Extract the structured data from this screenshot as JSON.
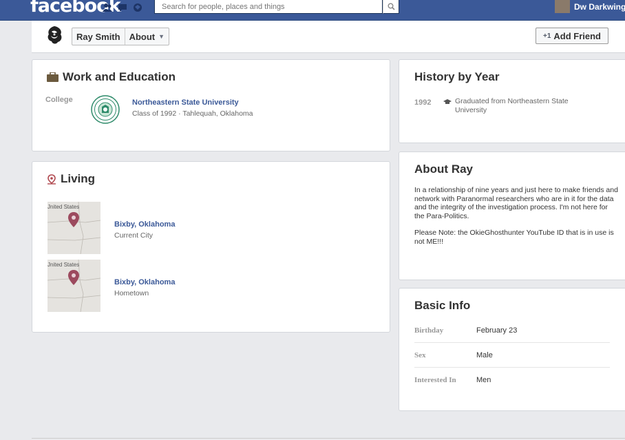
{
  "topbar": {
    "logo": "facebook",
    "search_placeholder": "Search for people, places and things",
    "user_name": "Dw Darkwing"
  },
  "profile": {
    "name": "Ray Smith",
    "about_label": "About",
    "add_friend_label": "Add Friend"
  },
  "work": {
    "title": "Work and Education",
    "college_label": "College",
    "school_name": "Northeastern State University",
    "school_detail": "Class of 1992 · Tahlequah, Oklahoma"
  },
  "living": {
    "title": "Living",
    "map_label": "Jnited States",
    "places": [
      {
        "name": "Bixby, Oklahoma",
        "type": "Current City"
      },
      {
        "name": "Bixby, Oklahoma",
        "type": "Hometown"
      }
    ]
  },
  "history": {
    "title": "History by Year",
    "year": "1992",
    "event": "Graduated from Northeastern State University"
  },
  "about": {
    "title": "About Ray",
    "paragraph1": "In a relationship of nine years and just here to make friends and network with Paranormal researchers who are in it for the data and the integrity of the investigation process. I'm not here for the Para-Politics.",
    "paragraph2": "Please Note: the OkieGhosthunter YouTube ID that is in use is not ME!!!"
  },
  "basic": {
    "title": "Basic Info",
    "rows": [
      {
        "key": "Birthday",
        "value": "February 23"
      },
      {
        "key": "Sex",
        "value": "Male"
      },
      {
        "key": "Interested In",
        "value": "Men"
      }
    ]
  },
  "colors": {
    "brand": "#3b5998",
    "page_bg": "#e9eaed",
    "map_pin": "#9c4a5e"
  },
  "icons": [
    "friends-icon",
    "messages-icon",
    "notifications-icon",
    "search-icon",
    "briefcase-icon",
    "location-pin-icon",
    "graduation-cap-icon",
    "map-pin-icon"
  ]
}
